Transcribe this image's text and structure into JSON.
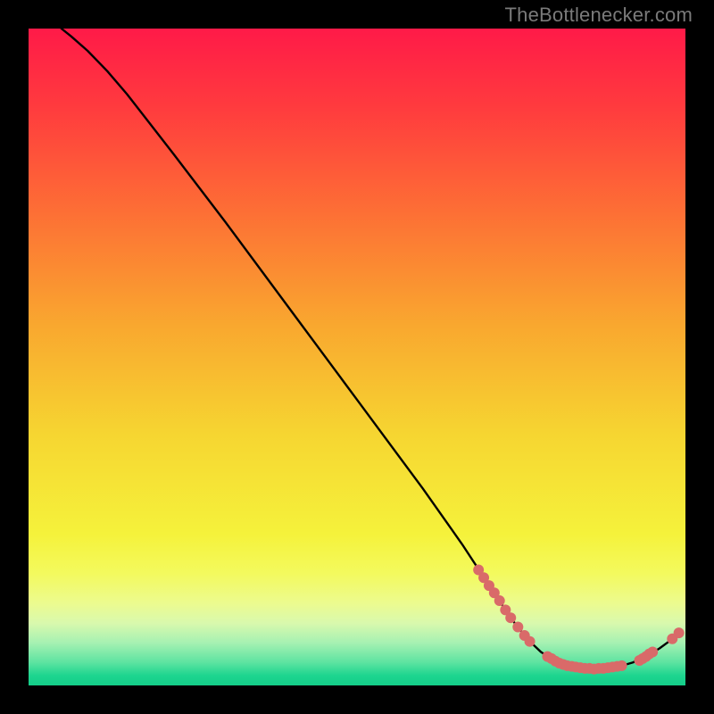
{
  "watermark": "TheBottlenecker.com",
  "chart_data": {
    "type": "line",
    "title": "",
    "xlabel": "",
    "ylabel": "",
    "xlim": [
      0,
      100
    ],
    "ylim": [
      0,
      100
    ],
    "grid": false,
    "legend": false,
    "gradient_stops": [
      {
        "offset": 0.0,
        "color": "#ff1a48"
      },
      {
        "offset": 0.12,
        "color": "#ff3b3e"
      },
      {
        "offset": 0.28,
        "color": "#fd6f35"
      },
      {
        "offset": 0.45,
        "color": "#f9a72f"
      },
      {
        "offset": 0.62,
        "color": "#f6d631"
      },
      {
        "offset": 0.77,
        "color": "#f5f23b"
      },
      {
        "offset": 0.83,
        "color": "#f3fa5e"
      },
      {
        "offset": 0.875,
        "color": "#ecfb8f"
      },
      {
        "offset": 0.905,
        "color": "#d9f9ad"
      },
      {
        "offset": 0.935,
        "color": "#a6f1b2"
      },
      {
        "offset": 0.965,
        "color": "#5de3a1"
      },
      {
        "offset": 0.985,
        "color": "#1dd58f"
      },
      {
        "offset": 1.0,
        "color": "#14cd89"
      }
    ],
    "curve": [
      {
        "x": 5.0,
        "y": 100.0
      },
      {
        "x": 6.5,
        "y": 98.8
      },
      {
        "x": 9.0,
        "y": 96.6
      },
      {
        "x": 12.0,
        "y": 93.5
      },
      {
        "x": 15.0,
        "y": 90.0
      },
      {
        "x": 22.0,
        "y": 81.0
      },
      {
        "x": 30.0,
        "y": 70.5
      },
      {
        "x": 40.0,
        "y": 57.0
      },
      {
        "x": 50.0,
        "y": 43.5
      },
      {
        "x": 60.0,
        "y": 30.0
      },
      {
        "x": 66.0,
        "y": 21.5
      },
      {
        "x": 70.0,
        "y": 15.4
      },
      {
        "x": 72.0,
        "y": 12.4
      },
      {
        "x": 74.0,
        "y": 9.5
      },
      {
        "x": 76.0,
        "y": 7.0
      },
      {
        "x": 78.0,
        "y": 5.1
      },
      {
        "x": 80.0,
        "y": 3.8
      },
      {
        "x": 82.0,
        "y": 3.0
      },
      {
        "x": 84.0,
        "y": 2.6
      },
      {
        "x": 86.0,
        "y": 2.5
      },
      {
        "x": 88.0,
        "y": 2.6
      },
      {
        "x": 90.0,
        "y": 2.9
      },
      {
        "x": 92.0,
        "y": 3.5
      },
      {
        "x": 94.0,
        "y": 4.4
      },
      {
        "x": 96.0,
        "y": 5.6
      },
      {
        "x": 97.5,
        "y": 6.7
      },
      {
        "x": 99.0,
        "y": 8.0
      }
    ],
    "dot_color": "#d96a69",
    "dot_radius": 6,
    "dots_left": [
      {
        "x": 68.5,
        "y": 17.6
      },
      {
        "x": 69.3,
        "y": 16.4
      },
      {
        "x": 70.1,
        "y": 15.2
      },
      {
        "x": 70.9,
        "y": 14.1
      },
      {
        "x": 71.7,
        "y": 12.9
      },
      {
        "x": 72.6,
        "y": 11.5
      },
      {
        "x": 73.4,
        "y": 10.3
      },
      {
        "x": 74.5,
        "y": 8.9
      },
      {
        "x": 75.5,
        "y": 7.6
      },
      {
        "x": 76.3,
        "y": 6.7
      }
    ],
    "dots_bottom": [
      {
        "x": 79.0,
        "y": 4.4
      },
      {
        "x": 79.6,
        "y": 4.1
      },
      {
        "x": 80.2,
        "y": 3.7
      },
      {
        "x": 80.8,
        "y": 3.4
      },
      {
        "x": 81.4,
        "y": 3.2
      },
      {
        "x": 82.0,
        "y": 3.0
      },
      {
        "x": 82.7,
        "y": 2.9
      },
      {
        "x": 83.3,
        "y": 2.8
      },
      {
        "x": 84.0,
        "y": 2.7
      },
      {
        "x": 84.7,
        "y": 2.6
      },
      {
        "x": 85.4,
        "y": 2.6
      },
      {
        "x": 86.1,
        "y": 2.5
      },
      {
        "x": 86.8,
        "y": 2.6
      },
      {
        "x": 87.5,
        "y": 2.6
      },
      {
        "x": 88.2,
        "y": 2.7
      },
      {
        "x": 88.9,
        "y": 2.8
      },
      {
        "x": 89.6,
        "y": 2.9
      },
      {
        "x": 90.3,
        "y": 3.0
      }
    ],
    "dots_right": [
      {
        "x": 93.0,
        "y": 3.8
      },
      {
        "x": 93.5,
        "y": 4.1
      },
      {
        "x": 94.0,
        "y": 4.4
      },
      {
        "x": 94.5,
        "y": 4.8
      },
      {
        "x": 95.0,
        "y": 5.1
      }
    ],
    "dots_tip": [
      {
        "x": 98.0,
        "y": 7.1
      },
      {
        "x": 99.0,
        "y": 8.0
      }
    ]
  }
}
